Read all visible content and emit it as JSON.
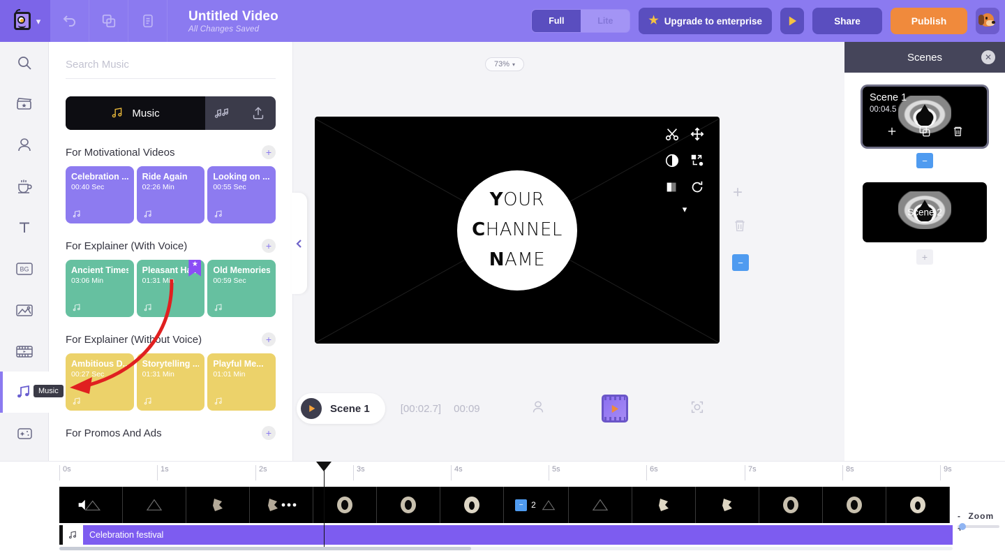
{
  "header": {
    "title": "Untitled Video",
    "subtitle": "All Changes Saved",
    "undo_icon": "undo-icon",
    "duplicate_icon": "duplicate-icon",
    "notes_icon": "notes-icon",
    "brand_icon": "monster-logo",
    "chevron_icon": "chevron-down-icon",
    "mode_toggle": {
      "full": "Full",
      "lite": "Lite",
      "selected": "Full"
    },
    "upgrade_label": "Upgrade to enterprise",
    "upgrade_star": "star-icon",
    "preview_icon": "play-icon",
    "share_label": "Share",
    "publish_label": "Publish",
    "avatar_icon": "dog-avatar",
    "colors": {
      "bar": "#8b7af0",
      "button": "#5a4ebf",
      "publish": "#f08a3c"
    }
  },
  "rail": {
    "items": [
      {
        "name": "search",
        "icon": "search-icon",
        "active": false
      },
      {
        "name": "templates",
        "icon": "clapperboard-icon",
        "active": false
      },
      {
        "name": "characters",
        "icon": "person-icon",
        "active": false
      },
      {
        "name": "props",
        "icon": "coffee-cup-icon",
        "active": false
      },
      {
        "name": "text",
        "icon": "text-t-icon",
        "active": false
      },
      {
        "name": "background",
        "icon": "bg-icon",
        "label": "BG",
        "active": false
      },
      {
        "name": "images",
        "icon": "image-icon",
        "active": false
      },
      {
        "name": "video",
        "icon": "film-icon",
        "active": false
      },
      {
        "name": "music",
        "icon": "music-note-icon",
        "active": true,
        "tooltip": "Music"
      },
      {
        "name": "effects",
        "icon": "sparkle-icon",
        "active": false
      }
    ],
    "bottom": [
      {
        "name": "filmstrip",
        "icon": "filmstrip-icon"
      },
      {
        "name": "voiceover",
        "icon": "microphone-plus-icon"
      }
    ]
  },
  "panel": {
    "search_placeholder": "Search Music",
    "search_value": "",
    "tabs": [
      {
        "label": "Music",
        "icon": "music-note-icon",
        "active": true
      },
      {
        "label": "",
        "icon": "sound-effects-icon",
        "active": false
      },
      {
        "label": "",
        "icon": "upload-icon",
        "active": false
      }
    ],
    "collapse_icon": "chevron-left-icon",
    "groups": [
      {
        "title": "For Motivational Videos",
        "add_icon": "plus-icon",
        "color": "#8d7bf0",
        "tracks": [
          {
            "name": "Celebration ...",
            "duration": "00:40 Sec",
            "icon": "music-note-icon",
            "featured": false
          },
          {
            "name": "Ride Again",
            "duration": "02:26 Min",
            "icon": "music-note-icon",
            "featured": false
          },
          {
            "name": "Looking on ...",
            "duration": "00:55 Sec",
            "icon": "music-note-icon",
            "featured": false
          }
        ]
      },
      {
        "title": "For Explainer (With Voice)",
        "add_icon": "plus-icon",
        "color": "#66c0a0",
        "tracks": [
          {
            "name": "Ancient Times",
            "duration": "03:06 Min",
            "icon": "music-note-icon",
            "featured": false
          },
          {
            "name": "Pleasant Ha...",
            "duration": "01:31 Min",
            "icon": "music-note-icon",
            "featured": true
          },
          {
            "name": "Old Memories",
            "duration": "00:59 Sec",
            "icon": "music-note-icon",
            "featured": false
          }
        ]
      },
      {
        "title": "For Explainer (Without Voice)",
        "add_icon": "plus-icon",
        "color": "#ecd26a",
        "tracks": [
          {
            "name": "Ambitious D...",
            "duration": "00:27 Sec",
            "icon": "music-note-icon",
            "featured": false
          },
          {
            "name": "Storytelling ...",
            "duration": "01:31 Min",
            "icon": "music-note-icon",
            "featured": false
          },
          {
            "name": "Playful Me...",
            "duration": "01:01 Min",
            "icon": "music-note-icon",
            "featured": false
          }
        ]
      },
      {
        "title": "For Promos And Ads",
        "add_icon": "plus-icon",
        "color": "#8d7bf0",
        "tracks": []
      }
    ]
  },
  "stage": {
    "zoom_level": "73%",
    "zoom_caret": "chevron-down-icon",
    "canvas_text_lines": [
      "YOUR",
      "CHANNEL",
      "NAME"
    ],
    "canvas_tools": [
      {
        "name": "cut",
        "icon": "scissors-icon"
      },
      {
        "name": "move",
        "icon": "move-arrows-icon"
      },
      {
        "name": "opacity",
        "icon": "half-circle-icon"
      },
      {
        "name": "replace",
        "icon": "swap-icon"
      },
      {
        "name": "color-split",
        "icon": "color-split-icon"
      },
      {
        "name": "rotate",
        "icon": "rotate-icon"
      },
      {
        "name": "more",
        "icon": "chevron-down-icon"
      }
    ],
    "side_tools": [
      {
        "name": "add",
        "icon": "plus-icon"
      },
      {
        "name": "delete",
        "icon": "trash-icon"
      },
      {
        "name": "minus",
        "icon": "minus-icon",
        "color": "#4f9bf0"
      }
    ]
  },
  "player": {
    "scene_label": "Scene 1",
    "play_icon": "play-icon",
    "current_time": "[00:02.7]",
    "total_time": "00:09",
    "character_icon": "person-icon",
    "filmstrip_icon": "filmstrip-play-icon",
    "fit_icon": "fit-frame-icon"
  },
  "scenes": {
    "title": "Scenes",
    "close_icon": "close-icon",
    "items": [
      {
        "name": "Scene 1",
        "duration": "00:04.5",
        "selected": true,
        "label_position": "top-left",
        "actions": [
          {
            "name": "add-scene",
            "icon": "plus-icon"
          },
          {
            "name": "duplicate-scene",
            "icon": "duplicate-icon"
          },
          {
            "name": "delete-scene",
            "icon": "trash-icon"
          }
        ],
        "divider": {
          "icon": "minus-icon",
          "color": "#4f9bf0"
        }
      },
      {
        "name": "Scene 2",
        "duration": "",
        "selected": false,
        "label_position": "center",
        "actions": [],
        "divider": {
          "icon": "plus-icon",
          "color": "#f0f0f4"
        }
      }
    ]
  },
  "timeline": {
    "ruler_labels": [
      "0s",
      "1s",
      "2s",
      "3s",
      "4s",
      "5s",
      "6s",
      "7s",
      "8s",
      "9s"
    ],
    "playhead_time": "2.7s",
    "video_cells": [
      {
        "icon": "speaker-triangle-icon"
      },
      {
        "icon": "triangle-icon"
      },
      {
        "icon": "shape-icon"
      },
      {
        "icon": "shape-dots-icon"
      },
      {
        "icon": "orb-icon"
      },
      {
        "icon": "orb-icon"
      },
      {
        "icon": "orb-icon"
      },
      {
        "icon": "badge-minus",
        "badge": "2",
        "badge_icon": "minus-icon"
      },
      {
        "icon": "triangle-icon"
      },
      {
        "icon": "shape-icon"
      },
      {
        "icon": "shape-icon"
      },
      {
        "icon": "orb-icon"
      },
      {
        "icon": "orb-icon"
      },
      {
        "icon": "orb-icon"
      }
    ],
    "audio_track": {
      "name": "Celebration festival",
      "icon": "music-note-icon",
      "color": "#7d5cf0"
    },
    "zoom": {
      "minus": "-",
      "label": "Zoom",
      "plus": "+",
      "value": 4
    }
  },
  "annotation": {
    "type": "red-arrow",
    "color": "#e02020"
  }
}
